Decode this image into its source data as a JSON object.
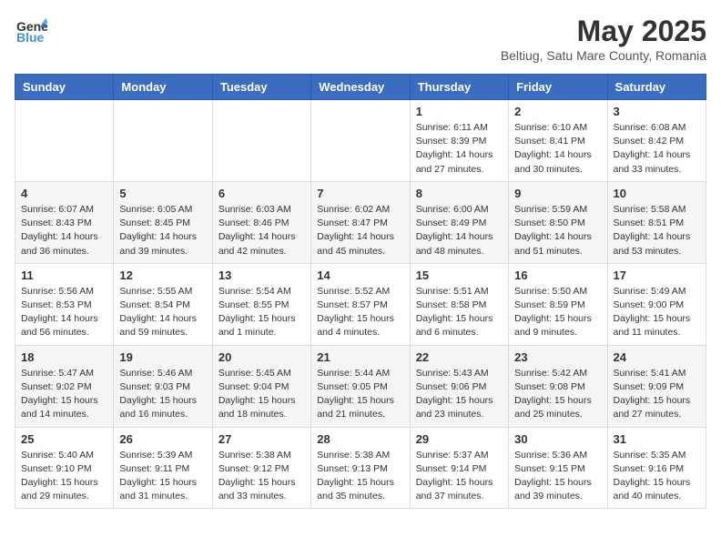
{
  "header": {
    "logo_general": "General",
    "logo_blue": "Blue",
    "month_year": "May 2025",
    "location": "Beltiug, Satu Mare County, Romania"
  },
  "weekdays": [
    "Sunday",
    "Monday",
    "Tuesday",
    "Wednesday",
    "Thursday",
    "Friday",
    "Saturday"
  ],
  "weeks": [
    [
      {
        "day": "",
        "info": ""
      },
      {
        "day": "",
        "info": ""
      },
      {
        "day": "",
        "info": ""
      },
      {
        "day": "",
        "info": ""
      },
      {
        "day": "1",
        "info": "Sunrise: 6:11 AM\nSunset: 8:39 PM\nDaylight: 14 hours\nand 27 minutes."
      },
      {
        "day": "2",
        "info": "Sunrise: 6:10 AM\nSunset: 8:41 PM\nDaylight: 14 hours\nand 30 minutes."
      },
      {
        "day": "3",
        "info": "Sunrise: 6:08 AM\nSunset: 8:42 PM\nDaylight: 14 hours\nand 33 minutes."
      }
    ],
    [
      {
        "day": "4",
        "info": "Sunrise: 6:07 AM\nSunset: 8:43 PM\nDaylight: 14 hours\nand 36 minutes."
      },
      {
        "day": "5",
        "info": "Sunrise: 6:05 AM\nSunset: 8:45 PM\nDaylight: 14 hours\nand 39 minutes."
      },
      {
        "day": "6",
        "info": "Sunrise: 6:03 AM\nSunset: 8:46 PM\nDaylight: 14 hours\nand 42 minutes."
      },
      {
        "day": "7",
        "info": "Sunrise: 6:02 AM\nSunset: 8:47 PM\nDaylight: 14 hours\nand 45 minutes."
      },
      {
        "day": "8",
        "info": "Sunrise: 6:00 AM\nSunset: 8:49 PM\nDaylight: 14 hours\nand 48 minutes."
      },
      {
        "day": "9",
        "info": "Sunrise: 5:59 AM\nSunset: 8:50 PM\nDaylight: 14 hours\nand 51 minutes."
      },
      {
        "day": "10",
        "info": "Sunrise: 5:58 AM\nSunset: 8:51 PM\nDaylight: 14 hours\nand 53 minutes."
      }
    ],
    [
      {
        "day": "11",
        "info": "Sunrise: 5:56 AM\nSunset: 8:53 PM\nDaylight: 14 hours\nand 56 minutes."
      },
      {
        "day": "12",
        "info": "Sunrise: 5:55 AM\nSunset: 8:54 PM\nDaylight: 14 hours\nand 59 minutes."
      },
      {
        "day": "13",
        "info": "Sunrise: 5:54 AM\nSunset: 8:55 PM\nDaylight: 15 hours\nand 1 minute."
      },
      {
        "day": "14",
        "info": "Sunrise: 5:52 AM\nSunset: 8:57 PM\nDaylight: 15 hours\nand 4 minutes."
      },
      {
        "day": "15",
        "info": "Sunrise: 5:51 AM\nSunset: 8:58 PM\nDaylight: 15 hours\nand 6 minutes."
      },
      {
        "day": "16",
        "info": "Sunrise: 5:50 AM\nSunset: 8:59 PM\nDaylight: 15 hours\nand 9 minutes."
      },
      {
        "day": "17",
        "info": "Sunrise: 5:49 AM\nSunset: 9:00 PM\nDaylight: 15 hours\nand 11 minutes."
      }
    ],
    [
      {
        "day": "18",
        "info": "Sunrise: 5:47 AM\nSunset: 9:02 PM\nDaylight: 15 hours\nand 14 minutes."
      },
      {
        "day": "19",
        "info": "Sunrise: 5:46 AM\nSunset: 9:03 PM\nDaylight: 15 hours\nand 16 minutes."
      },
      {
        "day": "20",
        "info": "Sunrise: 5:45 AM\nSunset: 9:04 PM\nDaylight: 15 hours\nand 18 minutes."
      },
      {
        "day": "21",
        "info": "Sunrise: 5:44 AM\nSunset: 9:05 PM\nDaylight: 15 hours\nand 21 minutes."
      },
      {
        "day": "22",
        "info": "Sunrise: 5:43 AM\nSunset: 9:06 PM\nDaylight: 15 hours\nand 23 minutes."
      },
      {
        "day": "23",
        "info": "Sunrise: 5:42 AM\nSunset: 9:08 PM\nDaylight: 15 hours\nand 25 minutes."
      },
      {
        "day": "24",
        "info": "Sunrise: 5:41 AM\nSunset: 9:09 PM\nDaylight: 15 hours\nand 27 minutes."
      }
    ],
    [
      {
        "day": "25",
        "info": "Sunrise: 5:40 AM\nSunset: 9:10 PM\nDaylight: 15 hours\nand 29 minutes."
      },
      {
        "day": "26",
        "info": "Sunrise: 5:39 AM\nSunset: 9:11 PM\nDaylight: 15 hours\nand 31 minutes."
      },
      {
        "day": "27",
        "info": "Sunrise: 5:38 AM\nSunset: 9:12 PM\nDaylight: 15 hours\nand 33 minutes."
      },
      {
        "day": "28",
        "info": "Sunrise: 5:38 AM\nSunset: 9:13 PM\nDaylight: 15 hours\nand 35 minutes."
      },
      {
        "day": "29",
        "info": "Sunrise: 5:37 AM\nSunset: 9:14 PM\nDaylight: 15 hours\nand 37 minutes."
      },
      {
        "day": "30",
        "info": "Sunrise: 5:36 AM\nSunset: 9:15 PM\nDaylight: 15 hours\nand 39 minutes."
      },
      {
        "day": "31",
        "info": "Sunrise: 5:35 AM\nSunset: 9:16 PM\nDaylight: 15 hours\nand 40 minutes."
      }
    ]
  ]
}
